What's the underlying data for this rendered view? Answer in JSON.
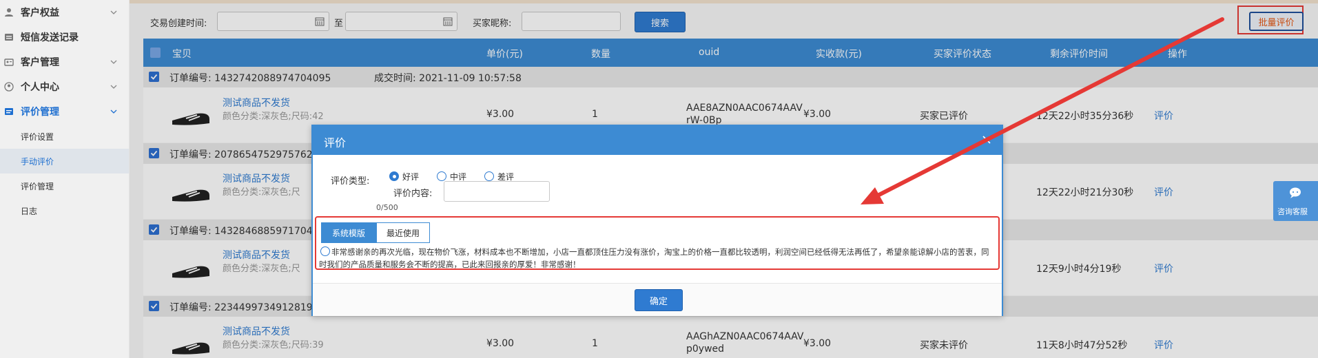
{
  "sidebar": {
    "items": [
      {
        "label": "客户权益",
        "icon": "user-shield-icon"
      },
      {
        "label": "短信发送记录",
        "icon": "message-icon"
      },
      {
        "label": "客户管理",
        "icon": "id-card-icon"
      },
      {
        "label": "个人中心",
        "icon": "person-icon"
      },
      {
        "label": "评价管理",
        "icon": "document-icon"
      }
    ],
    "sub_items": [
      {
        "label": "评价设置"
      },
      {
        "label": "手动评价"
      },
      {
        "label": "评价管理"
      },
      {
        "label": "日志"
      }
    ]
  },
  "filters": {
    "created_label": "交易创建时间:",
    "to_label": "至",
    "buyer_label": "买家昵称:",
    "search_button": "搜索",
    "batch_button": "批量评价"
  },
  "table": {
    "headers": [
      "宝贝",
      "单价(元)",
      "数量",
      "ouid",
      "实收款(元)",
      "买家评价状态",
      "剩余评价时间",
      "操作"
    ],
    "orders": [
      {
        "order_no": "订单编号: 1432742088974704095",
        "time": "成交时间: 2021-11-09 10:57:58",
        "title": "测试商品不发货",
        "sku": "颜色分类:深灰色;尺码:42",
        "price": "¥3.00",
        "qty": "1",
        "ouid_line1": "AAE8AZN0AAC0674AAV",
        "ouid_line2": "rW-0Bp",
        "paid": "¥3.00",
        "status": "买家已评价",
        "remaining": "12天22小时35分36秒",
        "action": "评价"
      },
      {
        "order_no": "订单编号: 20786547529757629",
        "title": "测试商品不发货",
        "sku": "颜色分类:深灰色;尺",
        "remaining": "12天22小时21分30秒",
        "action": "评价"
      },
      {
        "order_no": "订单编号: 14328468859717040",
        "title": "测试商品不发货",
        "sku": "颜色分类:深灰色;尺",
        "remaining": "12天9小时4分19秒",
        "action": "评价"
      },
      {
        "order_no": "订单编号: 22344997349128196",
        "title": "测试商品不发货",
        "sku": "颜色分类:深灰色;尺码:39",
        "price": "¥3.00",
        "qty": "1",
        "ouid_line1": "AAGhAZN0AAC0674AAV",
        "ouid_line2": "p0ywed",
        "paid": "¥3.00",
        "status": "买家未评价",
        "remaining": "11天8小时47分52秒",
        "action": "评价"
      }
    ]
  },
  "modal": {
    "title": "评价",
    "type_label": "评价类型:",
    "options": [
      "好评",
      "中评",
      "差评"
    ],
    "selected": "好评",
    "content_label": "评价内容:",
    "counter": "0/500",
    "tabs": [
      "系统模版",
      "最近使用"
    ],
    "template_text": "非常感谢亲的再次光临，现在物价飞涨，材料成本也不断增加，小店一直都顶住压力没有涨价，淘宝上的价格一直都比较透明，利润空间已经低得无法再低了，希望亲能谅解小店的苦衷，同时我们的产品质量和服务会不断的提高，已此来回报亲的厚爱！非常感谢！",
    "confirm_button": "确定"
  },
  "consult": {
    "label": "咨询客服",
    "icon": "chat-bubble-icon"
  },
  "colors": {
    "primary": "#3d8bd3",
    "highlight_red": "#e53935",
    "action_orange": "#e45511"
  }
}
